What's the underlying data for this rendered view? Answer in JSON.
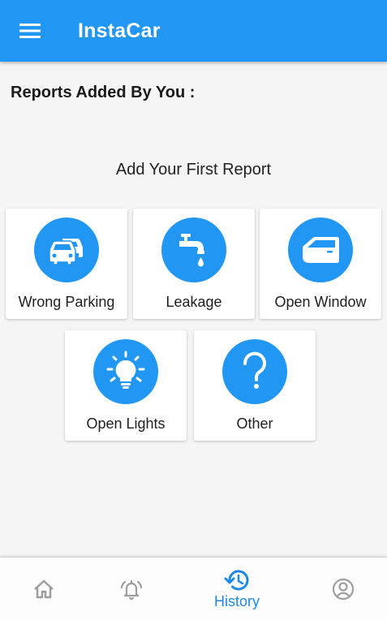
{
  "app": {
    "title": "InstaCar",
    "accent_color": "#2196f3",
    "menu_icon": "hamburger-menu-icon"
  },
  "main": {
    "section_heading": "Reports Added By You :",
    "empty_state_title": "Add Your First Report",
    "report_types": [
      {
        "label": "Wrong Parking",
        "icon": "parked-cars-icon"
      },
      {
        "label": "Leakage",
        "icon": "leaking-tap-icon"
      },
      {
        "label": "Open Window",
        "icon": "car-door-window-icon"
      },
      {
        "label": "Open Lights",
        "icon": "light-bulb-icon"
      },
      {
        "label": "Other",
        "icon": "question-mark-icon"
      }
    ]
  },
  "bottom_nav": {
    "items": [
      {
        "icon": "home-icon",
        "label": "",
        "active": false
      },
      {
        "icon": "bell-icon",
        "label": "",
        "active": false
      },
      {
        "icon": "history-icon",
        "label": "History",
        "active": true
      },
      {
        "icon": "account-icon",
        "label": "",
        "active": false
      }
    ],
    "active_color": "#1e88e5",
    "inactive_color": "#9e9e9e"
  }
}
